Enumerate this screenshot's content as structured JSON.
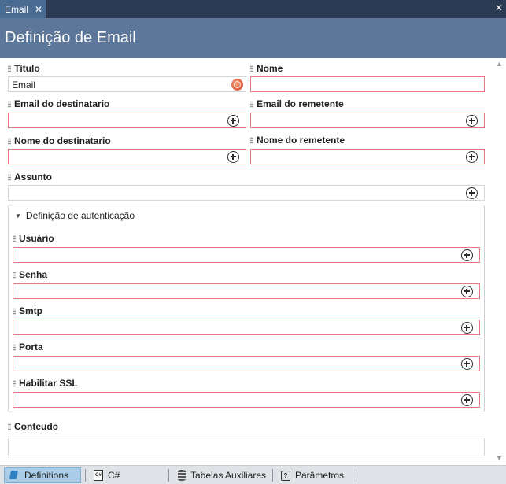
{
  "tab": {
    "label": "Email",
    "close": "✕"
  },
  "strip_close": "✕",
  "header": {
    "title": "Definição de Email"
  },
  "fields": {
    "titulo": {
      "label": "Título",
      "value": "Email"
    },
    "nome": {
      "label": "Nome",
      "value": ""
    },
    "email_destinatario": {
      "label": "Email do destinatario",
      "value": ""
    },
    "email_remetente": {
      "label": "Email do remetente",
      "value": ""
    },
    "nome_destinatario": {
      "label": "Nome do destinatario",
      "value": ""
    },
    "nome_remetente": {
      "label": "Nome do remetente",
      "value": ""
    },
    "assunto": {
      "label": "Assunto",
      "value": ""
    },
    "conteudo": {
      "label": "Conteudo",
      "value": ""
    }
  },
  "auth_group": {
    "title": "Definição de autenticação",
    "expanded": true,
    "fields": {
      "usuario": {
        "label": "Usuário",
        "value": ""
      },
      "senha": {
        "label": "Senha",
        "value": ""
      },
      "smtp": {
        "label": "Smtp",
        "value": ""
      },
      "porta": {
        "label": "Porta",
        "value": ""
      },
      "habilitar_ssl": {
        "label": "Habilitar SSL",
        "value": ""
      }
    }
  },
  "bottom_tabs": [
    {
      "label": "Definitions",
      "icon": "definitions-icon",
      "active": true
    },
    {
      "label": "C#",
      "icon": "csharp-file-icon",
      "active": false
    },
    {
      "label": "Tabelas Auxiliares",
      "icon": "database-icon",
      "active": false
    },
    {
      "label": "Parâmetros",
      "icon": "parameters-icon",
      "active": false
    }
  ],
  "colors": {
    "tab_strip": "#2b3b53",
    "header": "#5c7799",
    "required_border": "#e37b86",
    "active_bottom_tab": "#a9cde6"
  }
}
